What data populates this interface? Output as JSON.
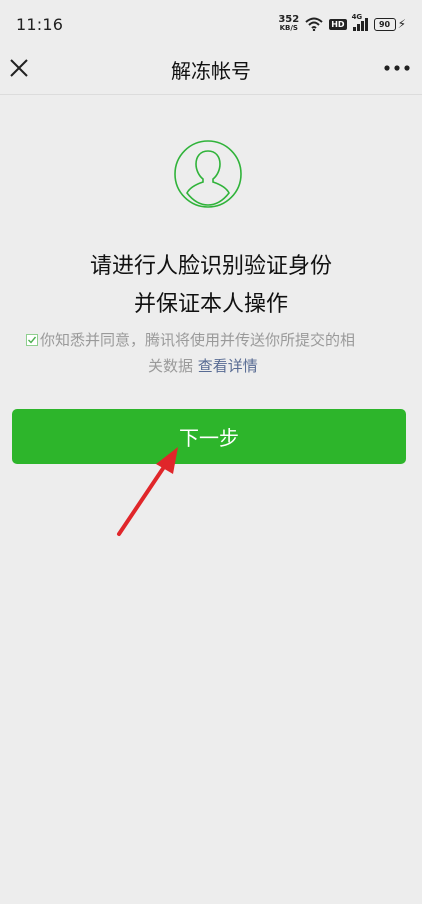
{
  "status_bar": {
    "time": "11:16",
    "net_speed_value": "352",
    "net_speed_unit": "KB/S",
    "hd_badge": "HD",
    "network_type": "4G",
    "battery_level": "90",
    "icons": [
      "wifi-icon",
      "hd-icon",
      "signal-4g-icon",
      "battery-icon",
      "charging-bolt-icon"
    ]
  },
  "nav": {
    "title": "解冻帐号",
    "close_icon": "close-icon",
    "more_icon": "more-dots-icon"
  },
  "content": {
    "avatar_icon": "user-avatar-outline-icon",
    "heading_line1": "请进行人脸识别验证身份",
    "heading_line2": "并保证本人操作",
    "agreement_line1": "你知悉并同意，腾讯将使用并传送你所提交的相",
    "agreement_line2_prefix": "关数据",
    "details_link": "查看详情",
    "agreement_checked": true
  },
  "actions": {
    "next_label": "下一步"
  },
  "annotation": {
    "arrow_color": "#e0262a",
    "arrow_icon": "red-pointer-arrow"
  },
  "colors": {
    "primary_green": "#2db52b",
    "avatar_green": "#30b33a",
    "link_blue": "#586b93",
    "background": "#ededed"
  }
}
